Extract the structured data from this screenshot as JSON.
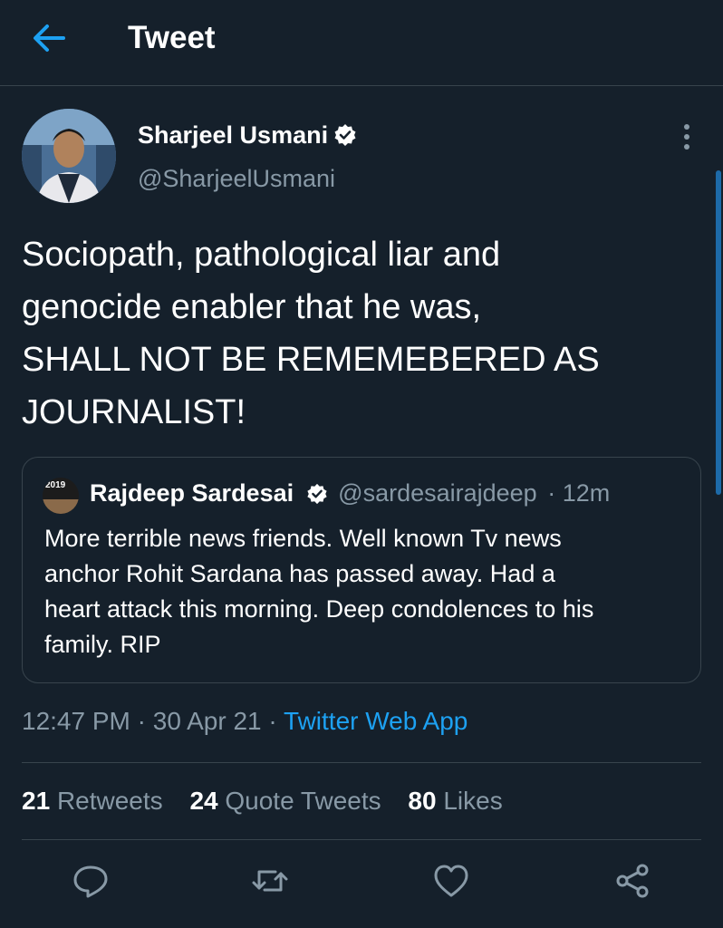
{
  "header": {
    "title": "Tweet"
  },
  "tweet": {
    "author_name": "Sharjeel Usmani",
    "author_handle": "@SharjeelUsmani",
    "text_lines": [
      "Sociopath, pathological liar and",
      "genocide enabler that he was,",
      "SHALL NOT BE REMEMEBERED AS",
      "JOURNALIST!"
    ],
    "time": "12:47 PM",
    "date": "30 Apr 21",
    "source": "Twitter Web App"
  },
  "quote": {
    "author_name": "Rajdeep Sardesai",
    "author_handle": "@sardesairajdeep",
    "age": "12m",
    "avatar_text": "2019",
    "text_lines": [
      "More terrible news friends. Well known Tv news",
      "anchor Rohit Sardana has passed away. Had a",
      "heart attack this morning. Deep condolences to his",
      "family. RIP"
    ]
  },
  "stats": {
    "retweets_count": "21",
    "retweets_label": "Retweets",
    "quotes_count": "24",
    "quotes_label": "Quote Tweets",
    "likes_count": "80",
    "likes_label": "Likes"
  },
  "colors": {
    "background": "#15202b",
    "accent": "#1da1f2",
    "secondary_text": "#8899a6",
    "border": "#38444d"
  },
  "icons": {
    "back": "arrow-left-icon",
    "more": "more-vertical-icon",
    "verified": "verified-badge-icon",
    "reply": "reply-icon",
    "retweet": "retweet-icon",
    "like": "heart-icon",
    "share": "share-icon"
  }
}
